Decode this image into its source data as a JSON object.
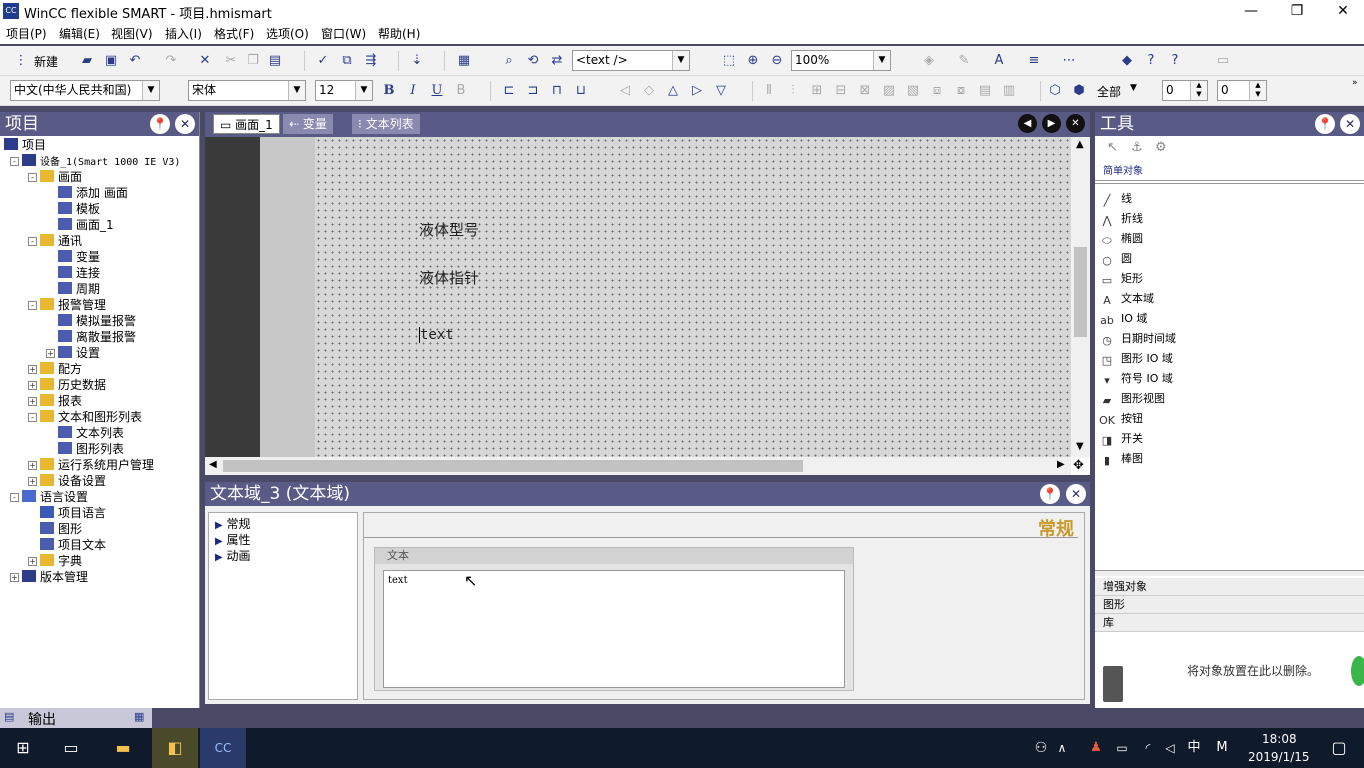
{
  "window": {
    "title": "WinCC flexible SMART - 项目.hmismart",
    "app_icon": "CC",
    "minimize": "—",
    "restore": "❐",
    "close": "✕"
  },
  "menu": [
    "项目(P)",
    "编辑(E)",
    "视图(V)",
    "插入(I)",
    "格式(F)",
    "选项(O)",
    "窗口(W)",
    "帮助(H)"
  ],
  "toolbar1": {
    "new_label": "新建",
    "text_dropdown": "<text />",
    "zoom": "100%"
  },
  "toolbar2": {
    "language": "中文(中华人民共和国)",
    "font": "宋体",
    "size": "12",
    "bold": "B",
    "italic": "I",
    "underline": "U",
    "all_label": "全部",
    "spin1": "0",
    "spin2": "0"
  },
  "project_panel": {
    "title": "项目",
    "tree": [
      {
        "label": "项目",
        "level": 0,
        "icon": "project-icon"
      },
      {
        "label": "设备_1(Smart 1000 IE V3)",
        "level": 1,
        "icon": "device-icon",
        "expand": "-"
      },
      {
        "label": "画面",
        "level": 2,
        "icon": "folder-icon",
        "expand": "-"
      },
      {
        "label": "添加 画面",
        "level": 3,
        "icon": "add-screen-icon"
      },
      {
        "label": "模板",
        "level": 3,
        "icon": "template-icon"
      },
      {
        "label": "画面_1",
        "level": 3,
        "icon": "screen-icon"
      },
      {
        "label": "通讯",
        "level": 2,
        "icon": "folder-icon",
        "expand": "-"
      },
      {
        "label": "变量",
        "level": 3,
        "icon": "tag-icon"
      },
      {
        "label": "连接",
        "level": 3,
        "icon": "connection-icon"
      },
      {
        "label": "周期",
        "level": 3,
        "icon": "cycle-icon"
      },
      {
        "label": "报警管理",
        "level": 2,
        "icon": "folder-icon",
        "expand": "-"
      },
      {
        "label": "模拟量报警",
        "level": 3,
        "icon": "analog-alarm-icon"
      },
      {
        "label": "离散量报警",
        "level": 3,
        "icon": "discrete-alarm-icon"
      },
      {
        "label": "设置",
        "level": 3,
        "icon": "settings-folder-icon",
        "expand": "+"
      },
      {
        "label": "配方",
        "level": 2,
        "icon": "folder-icon",
        "expand": "+"
      },
      {
        "label": "历史数据",
        "level": 2,
        "icon": "folder-icon",
        "expand": "+"
      },
      {
        "label": "报表",
        "level": 2,
        "icon": "folder-icon",
        "expand": "+"
      },
      {
        "label": "文本和图形列表",
        "level": 2,
        "icon": "folder-icon",
        "expand": "-"
      },
      {
        "label": "文本列表",
        "level": 3,
        "icon": "text-list-icon"
      },
      {
        "label": "图形列表",
        "level": 3,
        "icon": "graphic-list-icon"
      },
      {
        "label": "运行系统用户管理",
        "level": 2,
        "icon": "folder-icon",
        "expand": "+"
      },
      {
        "label": "设备设置",
        "level": 2,
        "icon": "folder-icon",
        "expand": "+"
      },
      {
        "label": "语言设置",
        "level": 1,
        "icon": "language-icon",
        "expand": "-"
      },
      {
        "label": "项目语言",
        "level": 2,
        "icon": "globe-icon"
      },
      {
        "label": "图形",
        "level": 2,
        "icon": "graphics-icon"
      },
      {
        "label": "项目文本",
        "level": 2,
        "icon": "project-text-icon"
      },
      {
        "label": "字典",
        "level": 2,
        "icon": "folder-icon",
        "expand": "+"
      },
      {
        "label": "版本管理",
        "level": 1,
        "icon": "version-icon",
        "expand": "+"
      }
    ]
  },
  "editor": {
    "tabs": [
      {
        "label": "画面_1",
        "active": true
      },
      {
        "label": "变量"
      },
      {
        "label": "文本列表"
      }
    ],
    "canvas_items": [
      "液体型号",
      "液体指针",
      "text"
    ]
  },
  "properties": {
    "title": "文本域_3 (文本域)",
    "nav": [
      "常规",
      "属性",
      "动画"
    ],
    "section_title": "常规",
    "group_label": "文本",
    "text_value": "text"
  },
  "tools": {
    "title": "工具",
    "category": "简单对象",
    "items": [
      {
        "label": "线",
        "icon": "line-icon"
      },
      {
        "label": "折线",
        "icon": "polyline-icon"
      },
      {
        "label": "椭圆",
        "icon": "ellipse-icon"
      },
      {
        "label": "圆",
        "icon": "circle-icon"
      },
      {
        "label": "矩形",
        "icon": "rectangle-icon"
      },
      {
        "label": "文本域",
        "icon": "text-field-icon"
      },
      {
        "label": "IO 域",
        "icon": "io-field-icon"
      },
      {
        "label": "日期时间域",
        "icon": "datetime-icon"
      },
      {
        "label": "图形 IO 域",
        "icon": "graphic-io-icon"
      },
      {
        "label": "符号 IO 域",
        "icon": "symbolic-io-icon"
      },
      {
        "label": "图形视图",
        "icon": "graphic-view-icon"
      },
      {
        "label": "按钮",
        "icon": "button-icon"
      },
      {
        "label": "开关",
        "icon": "switch-icon"
      },
      {
        "label": "棒图",
        "icon": "bar-icon"
      }
    ],
    "sections": [
      "增强对象",
      "图形",
      "库"
    ],
    "delete_hint": "将对象放置在此以删除。"
  },
  "output": {
    "label": "输出"
  },
  "taskbar": {
    "time": "18:08",
    "date": "2019/1/15",
    "ime": "中",
    "ime2": "M"
  },
  "colors": {
    "panel_header": "#5a5a86",
    "background": "#4a4a66",
    "canvas": "#d7d7d7",
    "accent": "#2a3c8a"
  }
}
